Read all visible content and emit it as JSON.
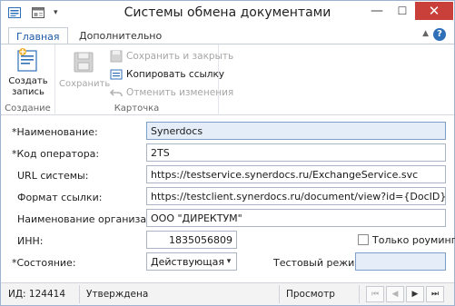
{
  "window": {
    "title": "Системы обмена документами",
    "controls": {
      "minimize": "—",
      "maximize": "☐",
      "close": "✕"
    }
  },
  "ribbon": {
    "tabs": [
      {
        "label": "Главная",
        "active": true
      },
      {
        "label": "Дополнительно",
        "active": false
      }
    ],
    "help": "?",
    "groups": {
      "create": {
        "label": "Создание",
        "create_button": "Создать запись"
      },
      "save": {
        "save_button": "Сохранить"
      },
      "card": {
        "label": "Карточка",
        "save_close": "Сохранить и закрыть",
        "copy_link": "Копировать ссылку",
        "undo": "Отменить изменения"
      }
    }
  },
  "form": {
    "name": {
      "label": "*Наименование:",
      "value": "Synerdocs"
    },
    "operator_code": {
      "label": "*Код оператора:",
      "value": "2TS"
    },
    "system_url": {
      "label": "URL системы:",
      "value": "https://testservice.synerdocs.ru/ExchangeService.svc"
    },
    "link_format": {
      "label": "Формат ссылки:",
      "value": "https://testclient.synerdocs.ru/document/view?id={DocID}"
    },
    "org_name": {
      "label": "Наименование организации:",
      "value": "ООО \"ДИРЕКТУМ\""
    },
    "inn": {
      "label": "ИНН:",
      "value": "1835056809"
    },
    "only_roaming": {
      "label": "Только роуминг",
      "checked": false
    },
    "state": {
      "label": "*Состояние:",
      "value": "Действующая"
    },
    "test_mode": {
      "label": "Тестовый режим:",
      "value": ""
    }
  },
  "statusbar": {
    "id": "ИД: 124414",
    "status": "Утверждена",
    "mode": "Просмотр",
    "nav": {
      "first": "⏮",
      "prev": "◀",
      "next": "▶",
      "last": "⏭"
    }
  },
  "colors": {
    "accent": "#1e5aa8",
    "close_button": "#c9403a",
    "focused_field": "#e5eef8"
  }
}
